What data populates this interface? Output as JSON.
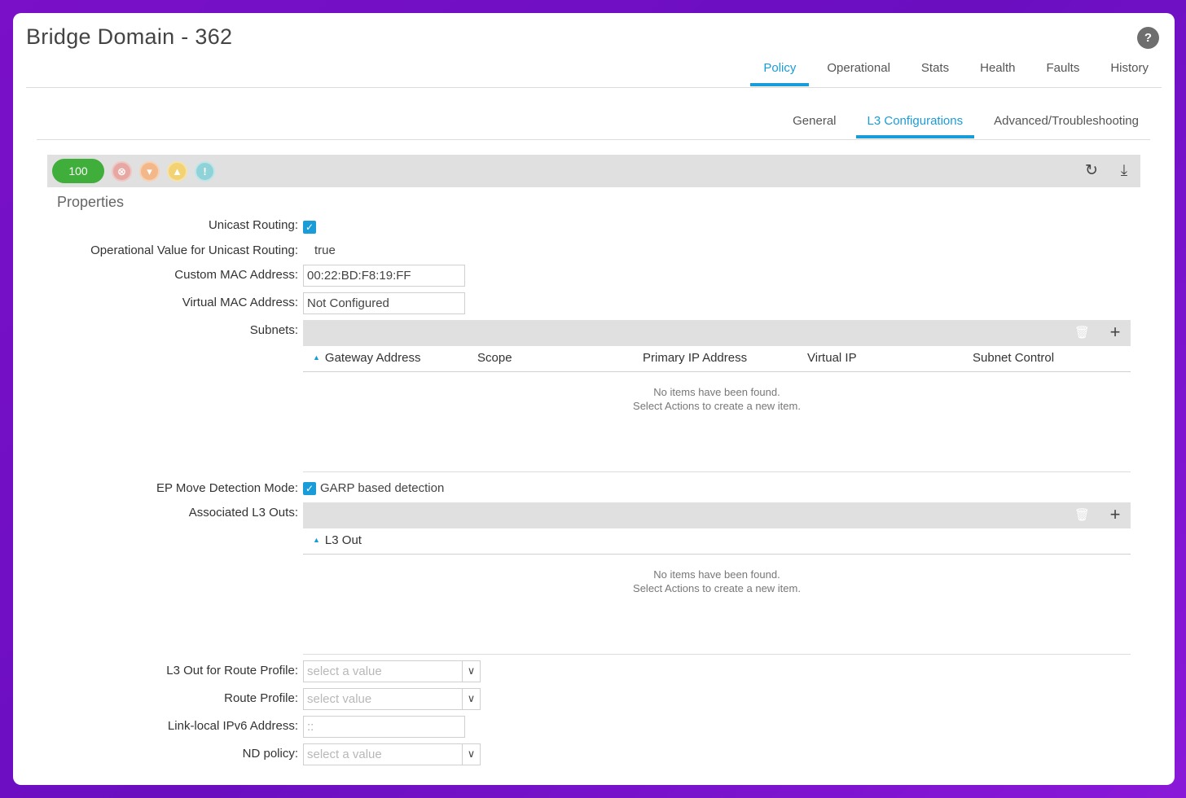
{
  "title": "Bridge Domain - 362",
  "help_icon": "?",
  "main_tabs": [
    "Policy",
    "Operational",
    "Stats",
    "Health",
    "Faults",
    "History"
  ],
  "main_tab_active": "Policy",
  "sub_tabs": [
    "General",
    "L3 Configurations",
    "Advanced/Troubleshooting"
  ],
  "sub_tab_active": "L3 Configurations",
  "fault_bar": {
    "health_score": "100",
    "icons": [
      "critical-fault-icon",
      "major-fault-icon",
      "minor-fault-icon",
      "warning-fault-icon"
    ],
    "refresh_icon": "refresh-icon",
    "download_icon": "download-icon"
  },
  "properties": {
    "section_title": "Properties",
    "unicast_routing_label": "Unicast Routing:",
    "unicast_routing_checked": true,
    "op_unicast_label": "Operational Value for Unicast Routing:",
    "op_unicast_value": "true",
    "custom_mac_label": "Custom MAC Address:",
    "custom_mac_value": "00:22:BD:F8:19:FF",
    "virtual_mac_label": "Virtual MAC Address:",
    "virtual_mac_value": "Not Configured",
    "subnets_label": "Subnets:",
    "ep_move_label": "EP Move Detection Mode:",
    "ep_move_option": "GARP based detection",
    "ep_move_checked": true,
    "assoc_l3_label": "Associated L3 Outs:",
    "l3out_route_profile_label": "L3 Out for Route Profile:",
    "l3out_route_profile_placeholder": "select a value",
    "route_profile_label": "Route Profile:",
    "route_profile_placeholder": "select value",
    "link_local_label": "Link-local IPv6 Address:",
    "link_local_value": "::",
    "nd_policy_label": "ND policy:",
    "nd_policy_placeholder": "select a value"
  },
  "subnets_table": {
    "columns": [
      "Gateway Address",
      "Scope",
      "Primary IP Address",
      "Virtual IP",
      "Subnet Control"
    ],
    "empty_line1": "No items have been found.",
    "empty_line2": "Select Actions to create a new item."
  },
  "l3outs_table": {
    "columns": [
      "L3 Out"
    ],
    "empty_line1": "No items have been found.",
    "empty_line2": "Select Actions to create a new item."
  }
}
